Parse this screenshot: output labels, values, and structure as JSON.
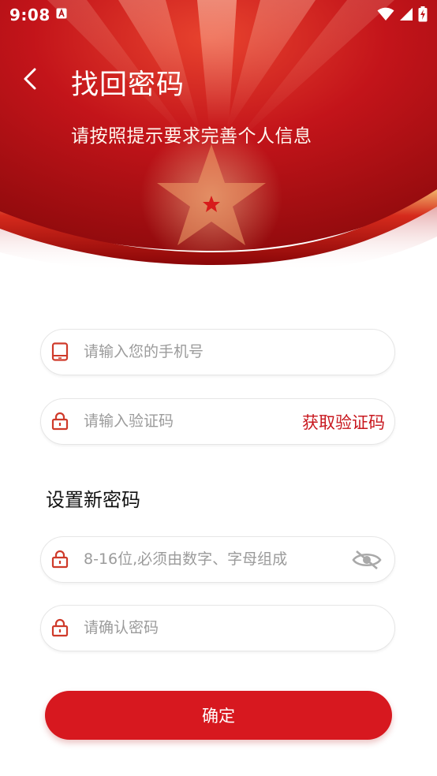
{
  "status_bar": {
    "time": "9:08",
    "notification_icon": "a-badge-icon",
    "icons": [
      "wifi-icon",
      "cellular-icon",
      "battery-charging-icon"
    ]
  },
  "header": {
    "back_icon": "chevron-left-icon",
    "title": "找回密码",
    "subtitle": "请按照提示要求完善个人信息"
  },
  "form": {
    "phone": {
      "placeholder": "请输入您的手机号",
      "icon": "phone-icon"
    },
    "code": {
      "placeholder": "请输入验证码",
      "icon": "lock-icon",
      "button_label": "获取验证码"
    },
    "section_title": "设置新密码",
    "new_password": {
      "placeholder": "8-16位,必须由数字、字母组成",
      "icon": "lock-icon",
      "toggle_icon": "eye-off-icon"
    },
    "confirm_password": {
      "placeholder": "请确认密码",
      "icon": "lock-icon"
    },
    "submit_label": "确定"
  },
  "colors": {
    "brand_red": "#d7181f",
    "accent_text_red": "#c8171e",
    "banner_red": "#b90f12"
  }
}
